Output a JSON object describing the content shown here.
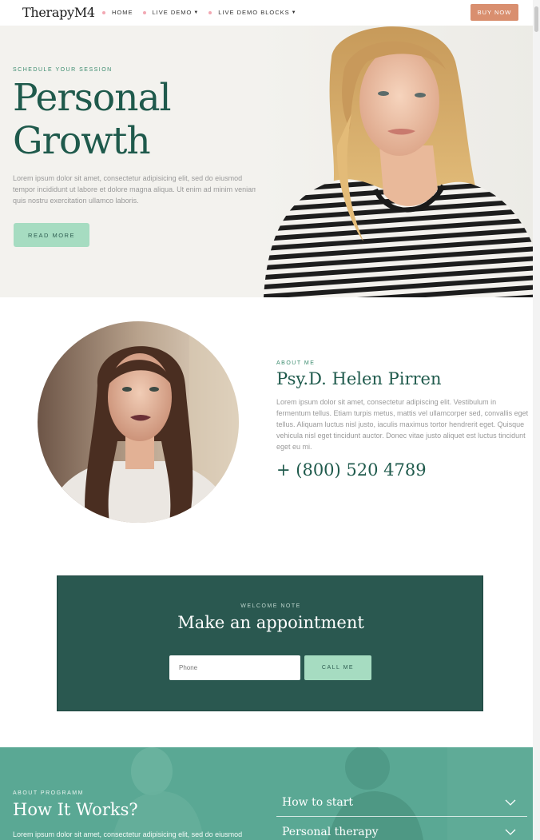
{
  "nav": {
    "logo": "TherapyM4",
    "items": [
      {
        "label": "HOME",
        "has_caret": false
      },
      {
        "label": "LIVE DEMO",
        "has_caret": true
      },
      {
        "label": "LIVE DEMO BLOCKS",
        "has_caret": true
      }
    ],
    "buy_label": "BUY NOW"
  },
  "hero": {
    "eyebrow": "SCHEDULE YOUR SESSION",
    "title_line1": "Personal",
    "title_line2": "Growth",
    "text": "Lorem ipsum dolor sit amet, consectetur adipisicing elit, sed do eiusmod tempor incididunt ut labore et dolore magna aliqua. Ut enim ad minim veniam, quis nostru exercitation ullamco laboris.",
    "button_label": "READ MORE"
  },
  "about": {
    "eyebrow": "ABOUT ME",
    "name": "Psy.D. Helen Pirren",
    "text": "Lorem ipsum dolor sit amet, consectetur adipiscing elit. Vestibulum in fermentum tellus. Etiam turpis metus, mattis vel ullamcorper sed, convallis eget tellus. Aliquam luctus nisl justo, iaculis maximus tortor hendrerit eget. Quisque vehicula nisl eget tincidunt auctor. Donec vitae justo aliquet est luctus tincidunt eget eu mi.",
    "phone": "+ (800) 520 4789"
  },
  "appointment": {
    "eyebrow": "WELCOME NOTE",
    "title": "Make an appointment",
    "phone_placeholder": "Phone",
    "button_label": "CALL ME"
  },
  "how": {
    "eyebrow": "ABOUT PROGRAMM",
    "title": "How It Works?",
    "text": "Lorem ipsum dolor sit amet, consectetur adipisicing elit, sed do eiusmod",
    "accordion": [
      {
        "label": "How to start"
      },
      {
        "label": "Personal therapy"
      }
    ]
  },
  "colors": {
    "brand_green": "#1f5a4c",
    "accent_mint": "#a6dcc1",
    "buy_orange": "#d98f6f",
    "appointment_bg": "#2a5850",
    "how_bg": "#5aa894",
    "nav_dot": "#f2a8b3"
  }
}
